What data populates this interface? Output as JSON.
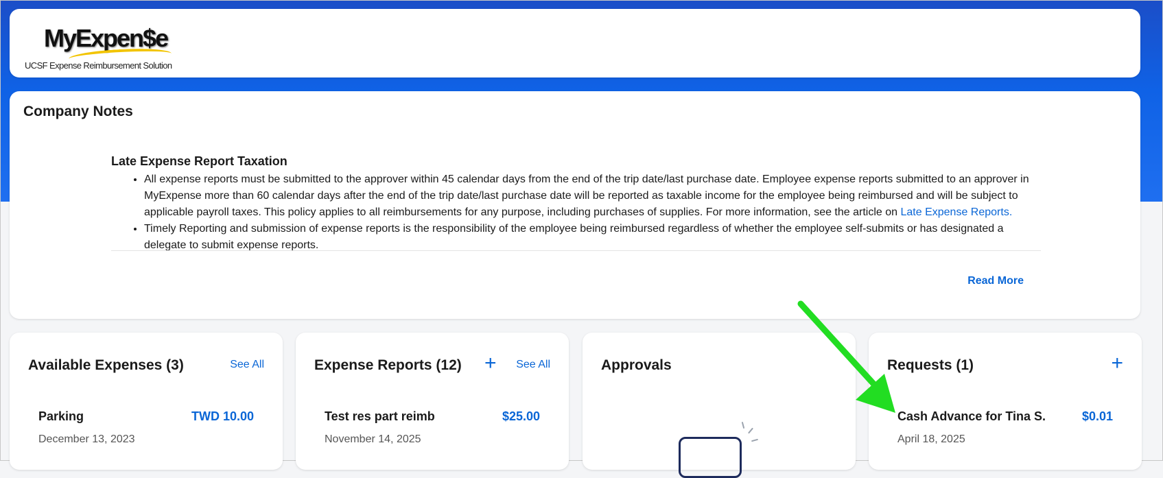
{
  "logo": {
    "main": "MyExpen$e",
    "sub": "UCSF Expense Reimbursement Solution"
  },
  "notes": {
    "title": "Company Notes",
    "heading": "Late Expense Report Taxation",
    "bullet1_text": "All expense reports must be submitted to the approver within 45 calendar days from the end of the trip date/last purchase date. Employee expense reports submitted to an approver in MyExpense more than 60 calendar days after the end of the trip date/last purchase date will be reported as taxable income for the employee being reimbursed and will be subject to applicable payroll taxes. This policy applies to all reimbursements for any purpose, including purchases of supplies. For more information, see the article on",
    "bullet1_link": "Late Expense Reports.",
    "bullet2_text": "Timely Reporting and submission of expense reports is the responsibility of the employee being reimbursed regardless of whether the employee self-submits or has designated a delegate to submit expense reports.",
    "read_more": "Read More"
  },
  "tiles": {
    "available": {
      "title": "Available Expenses (3)",
      "see_all": "See All",
      "item": {
        "name": "Parking",
        "amount": "TWD 10.00",
        "date": "December 13, 2023"
      }
    },
    "reports": {
      "title": "Expense Reports (12)",
      "plus": "+",
      "see_all": "See All",
      "item": {
        "name": "Test res part reimb",
        "amount": "$25.00",
        "date": "November 14, 2025"
      }
    },
    "approvals": {
      "title": "Approvals"
    },
    "requests": {
      "title": "Requests (1)",
      "plus": "+",
      "item": {
        "name": "Cash Advance for Tina S.",
        "amount": "$0.01",
        "date": "April 18, 2025"
      }
    }
  },
  "colors": {
    "brand_blue": "#1b4ec8",
    "link_blue": "#0a66d6",
    "annotation_arrow": "#22dd22"
  },
  "icons": {
    "plus": "plus-icon",
    "empty_state": "tray-icon",
    "annotation": "arrow-icon"
  }
}
